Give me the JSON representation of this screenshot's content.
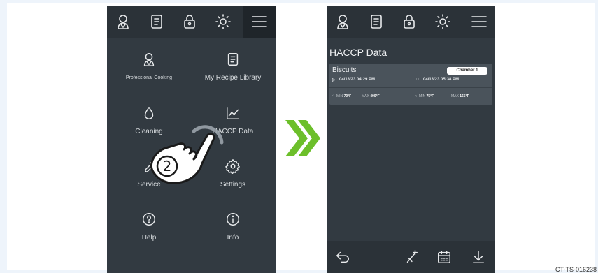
{
  "left_screen": {
    "menu_items": [
      {
        "label": "Professional Cooking",
        "icon": "chef-icon"
      },
      {
        "label": "My Recipe Library",
        "icon": "recipe-book-icon"
      },
      {
        "label": "Cleaning",
        "icon": "water-drop-icon"
      },
      {
        "label": "HACCP Data",
        "icon": "chart-icon"
      },
      {
        "label": "Service",
        "icon": "wrench-icon"
      },
      {
        "label": "Settings",
        "icon": "gear-icon"
      },
      {
        "label": "Help",
        "icon": "help-icon"
      },
      {
        "label": "Info",
        "icon": "info-icon"
      }
    ],
    "step_number": "2"
  },
  "right_screen": {
    "title": "HACCP Data",
    "record": {
      "name": "Biscuits",
      "chamber": "Chamber 1",
      "start": "04/13/23  04:29 PM",
      "end": "04/13/23  05:38 PM",
      "probe_min_label": "MIN",
      "probe_min": "70°F",
      "probe_max_label": "MAX",
      "probe_max": "400°F",
      "core_min_label": "MIN",
      "core_min": "75°F",
      "core_max_label": "MAX",
      "core_max": "165°F"
    }
  },
  "doc_code": "CT-TS-016238",
  "colors": {
    "screen_bg": "#323a41",
    "bar_bg": "#2b3238",
    "arrow": "#6cbf2a"
  }
}
